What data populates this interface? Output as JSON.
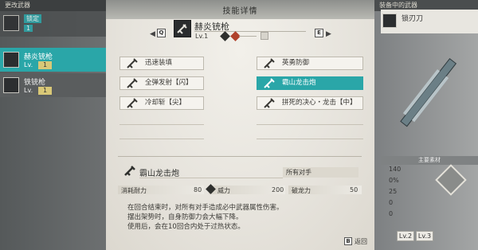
{
  "modal": {
    "title": "技能详情",
    "weapon_name": "赫炎铳枪",
    "weapon_level": "Lv.1",
    "prev_key": "Q",
    "next_key": "E",
    "back_key": "B",
    "back_label": "返回"
  },
  "skills": [
    {
      "label": "迅速装填",
      "selected": false
    },
    {
      "label": "英勇防御",
      "selected": false
    },
    {
      "label": "全弹发射【闪】",
      "selected": false
    },
    {
      "label": "霸山龙击炮",
      "selected": true
    },
    {
      "label": "冷却斩【尖】",
      "selected": false
    },
    {
      "label": "拼死的决心・龙击【中】",
      "selected": false
    }
  ],
  "detail": {
    "name": "霸山龙击炮",
    "target_label": "所有对手",
    "stats": [
      {
        "label": "消耗耐力",
        "value": "80"
      },
      {
        "label": "威力",
        "value": "200"
      },
      {
        "label": "破龙力",
        "value": "50"
      }
    ],
    "description": [
      "在回合结束时，对所有对手造成必中武器属性伤害。",
      "摆出架势时，自身防御力会大幅下降。",
      "使用后，会在10回合内处于过热状态。"
    ]
  },
  "left_panel": {
    "header": "更改武器",
    "items": [
      {
        "name": "",
        "tag": "锁定",
        "level": "1"
      },
      {
        "name": "赫炎铳枪",
        "level_label": "Lv.",
        "level": "1"
      },
      {
        "name": "铁铳枪",
        "level_label": "Lv.",
        "level": "1"
      }
    ]
  },
  "right_panel": {
    "header": "装备中的武器",
    "weapon_name": "锁刃刀",
    "section_label": "主要素材",
    "stats": [
      "140",
      "0%",
      "25",
      "0",
      "0"
    ],
    "levels": [
      "Lv.1",
      "Lv.2",
      "Lv.3"
    ]
  },
  "colors": {
    "accent": "#2aa6a8",
    "level_chip": "#d9c877"
  }
}
